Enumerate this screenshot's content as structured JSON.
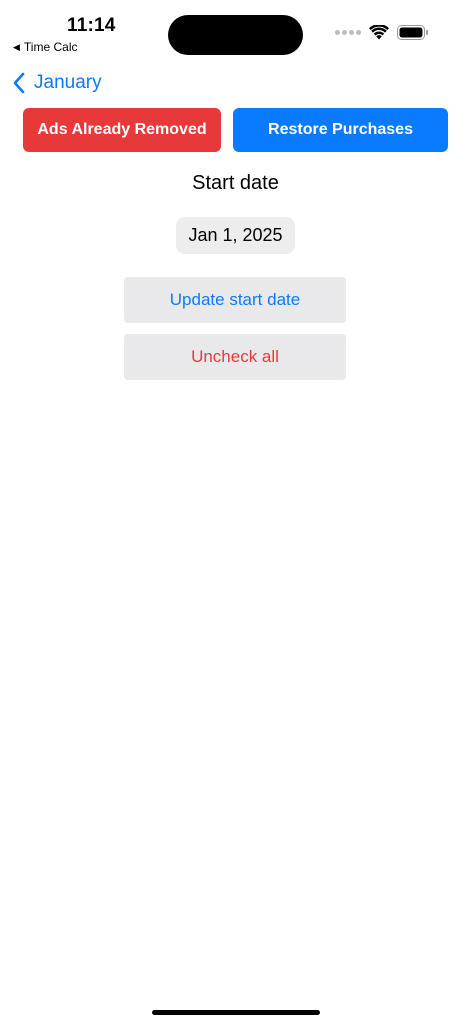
{
  "status_bar": {
    "time": "11:14",
    "back_app": "Time Calc"
  },
  "nav": {
    "back_label": "January"
  },
  "buttons": {
    "ads_removed": "Ads Already Removed",
    "restore": "Restore Purchases"
  },
  "start_date": {
    "label": "Start date",
    "value": "Jan 1, 2025"
  },
  "actions": {
    "update": "Update start date",
    "uncheck": "Uncheck all"
  },
  "colors": {
    "accent_blue": "#0A7AFF",
    "accent_red": "#E8393A",
    "button_gray": "#E9E9EB"
  }
}
